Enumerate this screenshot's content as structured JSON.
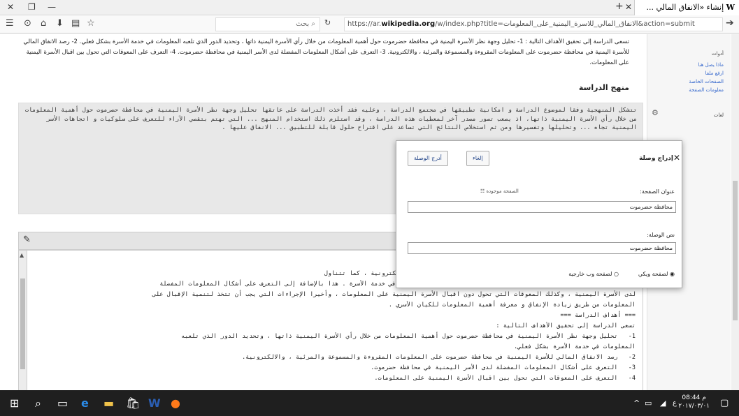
{
  "browser": {
    "tab_title": "إنشاء «الانفاق المالي ...",
    "url_prefix": "https://ar.",
    "url_domain": "wikipedia.org",
    "url_rest": "/w/index.php?title=الانفاق_المالي_للاسرة_اليمنية_على_المعلومات&action=submit",
    "search_placeholder": "بحث"
  },
  "article": {
    "intro": "تسعى الدراسة إلى تحقيق الأهداف التالية : 1- تحليل وجهة نظر الأسرة اليمنية في محافظة حضرموت حول أهمية المعلومات من خلال رأي الأسرة اليمنية ذاتها ، وتحديد الدور الذي تلعبه المعلومات في خدمة الأسرة بشكل فعلي. 2- رصد الانفاق المالي للأسرة اليمنية في محافظة حضرموت على المعلومات المقروءة والمسموعة والمرئية ، والالكترونية. 3- التعرف على أشكال المعلومات المفضلة لدى الأسر اليمنية في محافظة حضرموت. 4- التعرف على المعوقات التي تحول بين اقبال الأسرة اليمنية على المعلومات.",
    "heading": "منهج الدراسة",
    "preview": "تتشكل المنهجية وفقا لموضوع الدراسة و امكانية تطبيقها في مجتمع الدراسة ، وعليه فقد أخذت الدراسة على عاتقها تحليل وجهة نظر الأسرة اليمنية في محافظة حضرموت حول أهمية المعلومات من خلال رأي الأسرة اليمنية ذاتها، اذ يصعب تصور مصدر آخر لمعطيات هذه الدراسة ، وقد استلزم ذلك استخدام المنهج ... التي تهتم بتقصي الآراء للتعرف على سلوكيات و اتجاهات الأسر اليمنية تجاه ... وتحليلها وتفسيرها ومن ثم استخلاص النتائج التي تساعد على اقتراح حلول قابلة للتطبيق ... الانفاق عليها ."
  },
  "sidebar": {
    "tools_label": "أدوات",
    "items": [
      "ماذا يصل هنا",
      "ارفع ملفا",
      "الصفحات الخاصة",
      "معلومات الصفحة"
    ],
    "languages_label": "لغات"
  },
  "editor": {
    "text": "... في محافظة حضرموت على المعلومات المقروءة والمسموعة والمرئية والالكترونية ، كما تتناول\nوجهة نظر الأسرة اليمنية تجاه المعلومات ، وأهميتها والدور الذي تلعبه في خدمة الأسرة . هذا بالإضافة إلى التعرف على أشكال المعلومات المفضلة\nلدى الأسرة اليمنية ، وكذلك المعوقات التي تحول دون اقبال الأسرة اليمنية على المعلومات ، وأخيرا الإجراءات التي يجب أن تتخذ لتنمية الإقبال على\nالمعلومات من طريق زيادة الإنفاق و معرفة أهمية المعلومات للكيان الأسري .\n=== أهداف الدراسة ===\nتسعى الدراسة إلى تحقيق الأهداف التالية :\n1-   تحليل وجهة نظر الأسرة اليمنية في محافظة حضرموت حول أهمية المعلومات من خلال رأي الأسرة اليمنية ذاتها ، وتحديد الدور الذي تلعبه\nالمعلومات في خدمة الأسرة بشكل فعلي.\n2-   رصد الانفاق المالي للأسرة اليمنية في محافظة حضرموت على المعلومات المقروءة والمسموعة والمرئية ، والالكترونية.\n3-   التعرف على أشكال المعلومات المفضلة لدى الأسر اليمنية في محافظة حضرموت.\n4-   التعرف على المعوقات التي تحول بين اقبال الأسرة اليمنية على المعلومات."
  },
  "dialog": {
    "title": "إدراج وصلة",
    "insert_button": "أدرج الوصلة",
    "cancel_button": "إلغاء",
    "page_title_label": "عنوان الصفحة:",
    "page_exists": "الصفحة موجودة",
    "page_title_value": "محافظة حضرموت",
    "link_text_label": "نص الوصلة:",
    "link_text_value": "محافظة حضرموت",
    "radio_wiki": "لصفحة ويكي",
    "radio_external": "لصفحة وب خارجية"
  },
  "taskbar": {
    "time": "08:44 م",
    "date": "٢٠١٧/٠٣/٠١"
  }
}
